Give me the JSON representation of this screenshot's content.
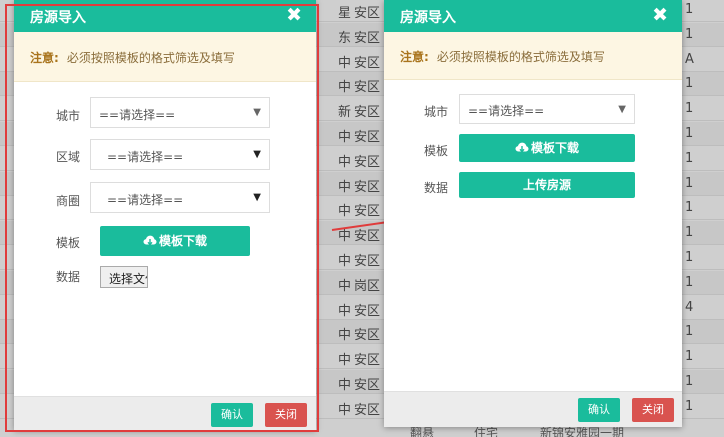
{
  "background": {
    "rows": [
      {
        "c1": "星",
        "c2": "安区",
        "c3": "1"
      },
      {
        "c1": "东",
        "c2": "安区",
        "c3": "1"
      },
      {
        "c1": "中",
        "c2": "安区",
        "c3": "A"
      },
      {
        "c1": "中",
        "c2": "安区",
        "c3": "1"
      },
      {
        "c1": "新",
        "c2": "安区",
        "c3": "1"
      },
      {
        "c1": "中",
        "c2": "安区",
        "c3": "1"
      },
      {
        "c1": "中",
        "c2": "安区",
        "c3": "1"
      },
      {
        "c1": "中",
        "c2": "安区",
        "c3": "1"
      },
      {
        "c1": "中",
        "c2": "安区",
        "c3": "1"
      },
      {
        "c1": "中",
        "c2": "安区",
        "c3": "1"
      },
      {
        "c1": "中",
        "c2": "安区",
        "c3": "1"
      },
      {
        "c1": "中",
        "c2": "岗区",
        "c3": "1"
      },
      {
        "c1": "中",
        "c2": "安区",
        "c3": "4"
      },
      {
        "c1": "中",
        "c2": "安区",
        "c3": "1"
      },
      {
        "c1": "中",
        "c2": "安区",
        "c3": "1"
      },
      {
        "c1": "中",
        "c2": "安区",
        "c3": "1"
      },
      {
        "c1": "中",
        "c2": "安区",
        "c3": "1"
      }
    ],
    "bottom_texts": [
      "翻悬",
      "住宅",
      "新锦安雅园一期"
    ]
  },
  "left_dialog": {
    "title": "房源导入",
    "notice_label": "注意:",
    "notice_text": "必须按照模板的格式筛选及填写",
    "city_label": "城市",
    "city_value": "==请选择==",
    "district_label": "区域",
    "district_value": "==请选择==",
    "area_label": "商圈",
    "area_value": "==请选择==",
    "template_label": "模板",
    "download_label": "模板下载",
    "data_label": "数据",
    "file_button": "选择文件",
    "ok_label": "确认",
    "close_label": "关闭"
  },
  "right_dialog": {
    "title": "房源导入",
    "notice_label": "注意:",
    "notice_text": "必须按照模板的格式筛选及填写",
    "city_label": "城市",
    "city_value": "==请选择==",
    "template_label": "模板",
    "download_label": "模板下载",
    "data_label": "数据",
    "upload_label": "上传房源",
    "ok_label": "确认",
    "close_label": "关闭"
  },
  "colors": {
    "accent": "#1abc9c",
    "danger": "#d9534f",
    "highlight_frame": "#e03c3c",
    "arrow": "#e03c3c"
  },
  "icons": {
    "close": "close-icon",
    "download": "cloud-download-icon",
    "dropdown": "chevron-down-icon",
    "arrow": "arrow-right-icon"
  }
}
